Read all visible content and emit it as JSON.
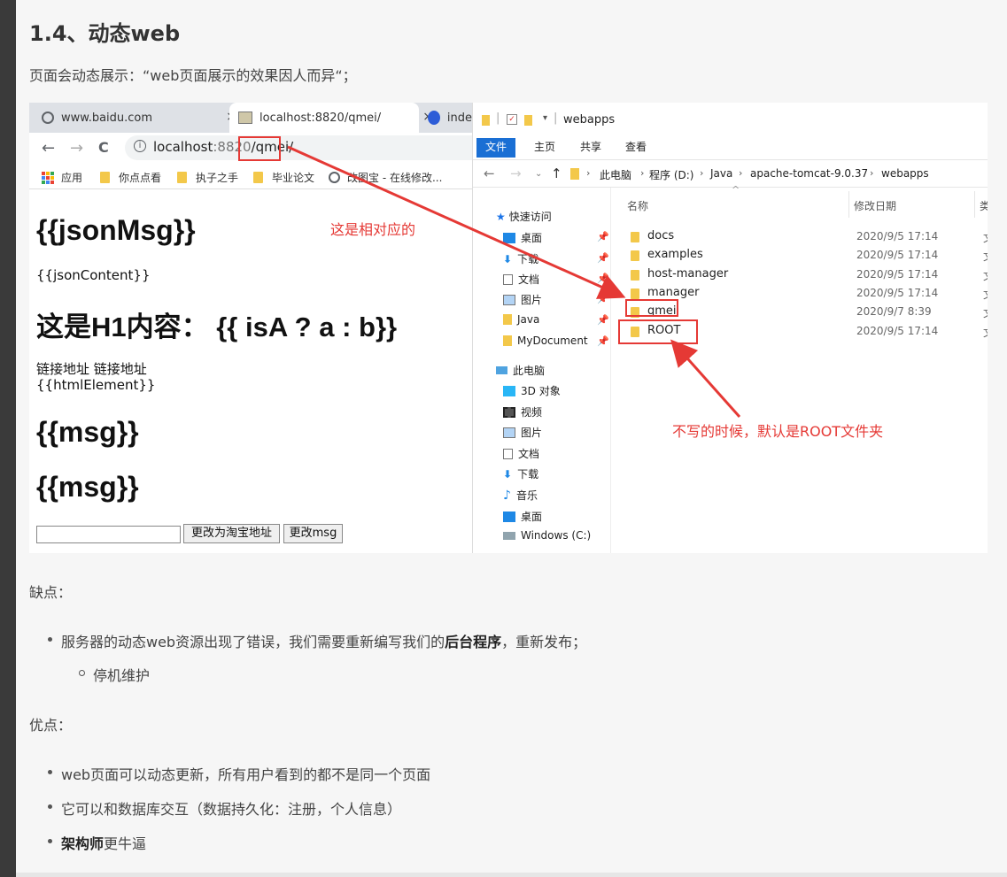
{
  "section_title": "1.4、动态web",
  "intro": "页面会动态展示：“web页面展示的效果因人而异“；",
  "browser": {
    "tabs": [
      {
        "label": "www.baidu.com",
        "close": "×"
      },
      {
        "label": "localhost:8820/qmei/",
        "close": "×"
      },
      {
        "label": "inde"
      }
    ],
    "nav": {
      "back": "←",
      "forward": "→",
      "reload": "C",
      "info": "i"
    },
    "url_host": "localhost",
    "url_port": ":8820",
    "url_path": "/qmei/",
    "bookmarks": [
      "应用",
      "你点点看",
      "执子之手",
      "毕业论文",
      "改图宝 - 在线修改..."
    ],
    "page": {
      "h_json_msg": "{{jsonMsg}}",
      "json_content": "{{jsonContent}}",
      "h1_content": "这是H1内容： {{ isA ? a : b}}",
      "links": "链接地址 链接地址",
      "html_element": "{{htmlElement}}",
      "msg1": "{{msg}}",
      "msg2": "{{msg}}",
      "btn_taobao": "更改为淘宝地址",
      "btn_msg": "更改msg"
    }
  },
  "explorer": {
    "title": "webapps",
    "ribbon": [
      "文件",
      "主页",
      "共享",
      "查看"
    ],
    "breadcrumbs": [
      "此电脑",
      "程序 (D:)",
      "Java",
      "apache-tomcat-9.0.37",
      "webapps"
    ],
    "tree_quick": "快速访问",
    "tree_quick_items": [
      "桌面",
      "下载",
      "文档",
      "图片",
      "Java",
      "MyDocument"
    ],
    "tree_pc": "此电脑",
    "tree_pc_items": [
      "3D 对象",
      "视频",
      "图片",
      "文档",
      "下载",
      "音乐",
      "桌面",
      "Windows (C:)"
    ],
    "col_name": "名称",
    "col_date": "修改日期",
    "col_type": "类",
    "files": [
      {
        "name": "docs",
        "date": "2020/9/5 17:14",
        "type": "文"
      },
      {
        "name": "examples",
        "date": "2020/9/5 17:14",
        "type": "文"
      },
      {
        "name": "host-manager",
        "date": "2020/9/5 17:14",
        "type": "文"
      },
      {
        "name": "manager",
        "date": "2020/9/5 17:14",
        "type": "文"
      },
      {
        "name": "qmei",
        "date": "2020/9/7 8:39",
        "type": "文"
      },
      {
        "name": "ROOT",
        "date": "2020/9/5 17:14",
        "type": "文"
      }
    ]
  },
  "annotations": {
    "corresponding": "这是相对应的",
    "root_default": "不写的时候，默认是ROOT文件夹",
    "color": "#e53935"
  },
  "cons_label": "缺点：",
  "cons_items": [
    {
      "pre": "服务器的动态web资源出现了错误，我们需要重新编写我们的",
      "bold": "后台程序",
      "post": "，重新发布；"
    }
  ],
  "cons_sub": "停机维护",
  "pros_label": "优点：",
  "pros_items": [
    "web页面可以动态更新，所有用户看到的都不是同一个页面",
    "它可以和数据库交互（数据持久化：注册，个人信息）"
  ],
  "pros_last_bold": "架构师",
  "pros_last_rest": "更牛逼"
}
